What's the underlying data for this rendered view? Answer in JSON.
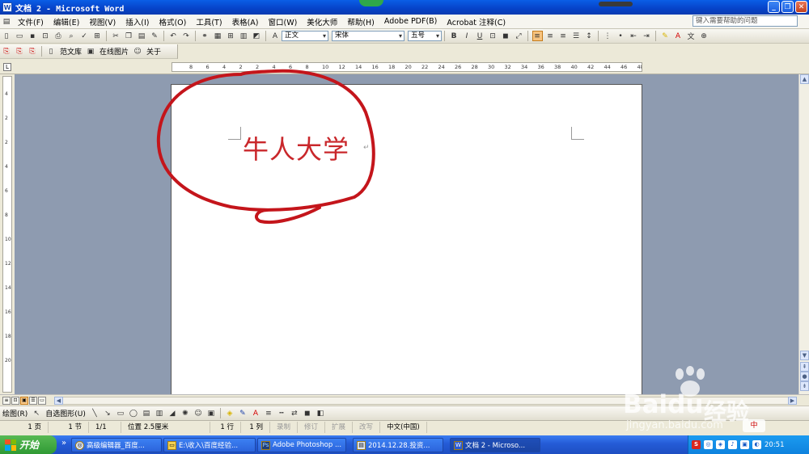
{
  "window": {
    "title": "文档 2 - Microsoft Word",
    "minimize": "_",
    "restore": "❐",
    "close": "✕"
  },
  "menubar": {
    "items": [
      "文件(F)",
      "编辑(E)",
      "视图(V)",
      "插入(I)",
      "格式(O)",
      "工具(T)",
      "表格(A)",
      "窗口(W)",
      "美化大师",
      "帮助(H)",
      "Adobe PDF(B)",
      "Acrobat 注释(C)"
    ],
    "help_placeholder": "键入需要帮助的问题"
  },
  "format_toolbar": {
    "style": "正文",
    "font": "宋体",
    "size": "五号",
    "bold": "B",
    "italic": "I",
    "underline": "U"
  },
  "toolbar3": {
    "template_label": "范文库",
    "online_image_label": "在线图片",
    "about_label": "关于"
  },
  "ruler": {
    "ticks": [
      "8",
      "6",
      "4",
      "2",
      "2",
      "4",
      "6",
      "8",
      "10",
      "12",
      "14",
      "16",
      "18",
      "20",
      "22",
      "24",
      "26",
      "28",
      "30",
      "32",
      "34",
      "36",
      "38",
      "40",
      "42",
      "44",
      "46",
      "48"
    ],
    "vticks": [
      "4",
      "2",
      "2",
      "4",
      "6",
      "8",
      "10",
      "12",
      "14",
      "16",
      "18",
      "20"
    ]
  },
  "document": {
    "text": "牛人大学"
  },
  "drawbar": {
    "draw_label": "绘图(R)",
    "autoshape_label": "自选图形(U)"
  },
  "statusbar": {
    "page": "1 页",
    "section": "1 节",
    "pages": "1/1",
    "position": "位置 2.5厘米",
    "line": "1 行",
    "column": "1 列",
    "rec": "录制",
    "trk": "修订",
    "ext": "扩展",
    "ovr": "改写",
    "language": "中文(中国)"
  },
  "taskbar": {
    "start": "开始",
    "tasks": [
      "高级编辑器_百度...",
      "E:\\收入\\百度经验...",
      "Adobe Photoshop ...",
      "2014.12.28.投资...",
      "文档 2 - Microso..."
    ],
    "clock": "20:51",
    "ime": "中"
  },
  "watermark": {
    "brand": "Baidu",
    "jingyan": "经验",
    "url": "jingyan.baidu.com"
  },
  "colors": {
    "title_blue": "#0a5ee6",
    "doc_text": "#c9272b",
    "annotation": "#c4151b",
    "workspace": "#8e9bb0",
    "taskbar_blue": "#245bd6",
    "start_green": "#3aa53c"
  }
}
